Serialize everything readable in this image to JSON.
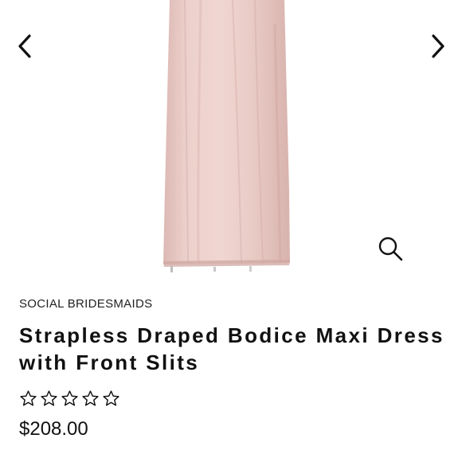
{
  "product": {
    "brand": "SOCIAL BRIDESMAIDS",
    "title": "Strapless Draped Bodice Maxi Dress with Front Slits",
    "price": "$208.00",
    "rating": 0,
    "rating_max": 5
  },
  "gallery": {
    "prev_icon": "chevron-left-icon",
    "next_icon": "chevron-right-icon",
    "zoom_icon": "magnifier-icon"
  },
  "colors": {
    "dress": "#e8c8c3",
    "dress_shadow": "#d6aea9",
    "text": "#111111"
  }
}
